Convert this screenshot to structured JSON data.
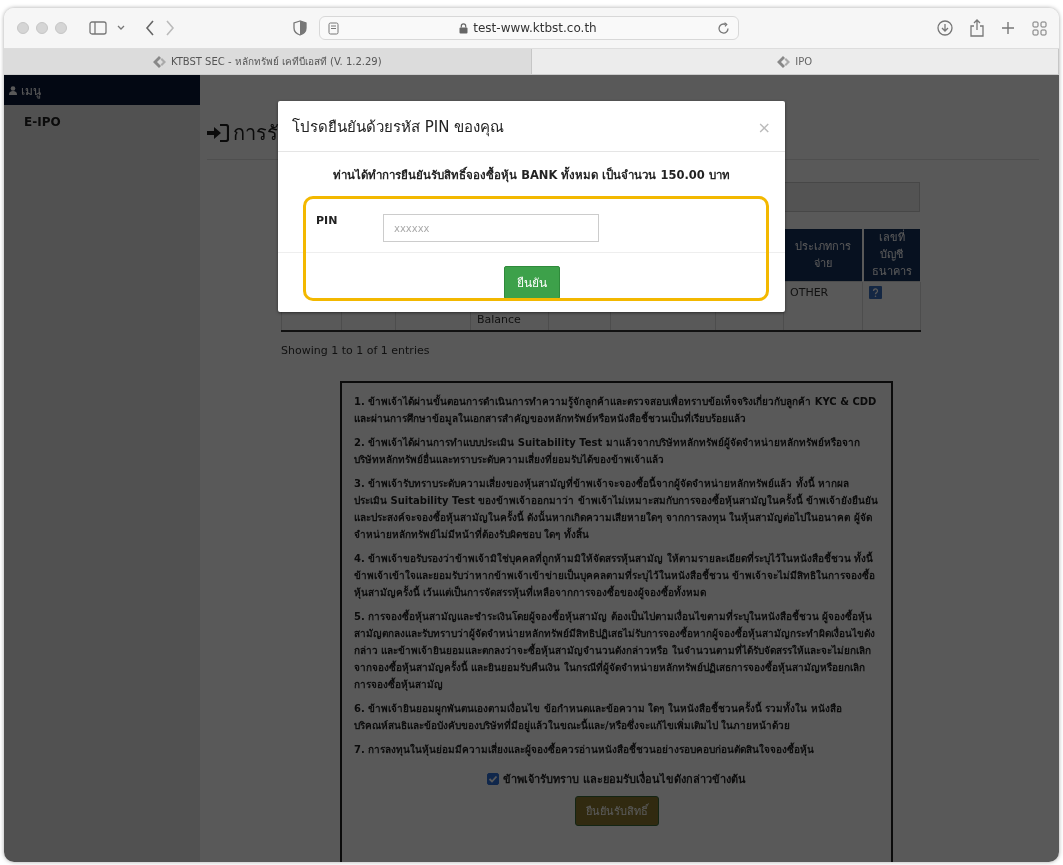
{
  "browser": {
    "url": "test-www.ktbst.co.th"
  },
  "tabs": [
    {
      "label": "KTBST SEC - หลักทรัพย์ เคทีบีเอสที (V. 1.2.29)",
      "selected": false
    },
    {
      "label": "IPO",
      "selected": true
    }
  ],
  "sidebar": {
    "header": "เมนู",
    "items": [
      {
        "label": "E-IPO"
      }
    ]
  },
  "page": {
    "heading": "การรั"
  },
  "table": {
    "columns": [
      "",
      "",
      "",
      "",
      "",
      "",
      "",
      "ประเภทการจ่าย",
      "เลขที่บัญชีธนาคาร"
    ],
    "rows": [
      {
        "cells": [
          "",
          "",
          "",
          "Balance",
          "",
          "",
          "",
          "OTHER",
          ""
        ]
      }
    ],
    "info": "Showing 1 to 1 of 1 entries"
  },
  "terms": [
    "1. ข้าพเจ้าได้ผ่านขั้นตอนการดำเนินการทำความรู้จักลูกค้าและตรวจสอบเพื่อทราบข้อเท็จจริงเกี่ยวกับลูกค้า KYC & CDD และผ่านการศึกษาข้อมูลในเอกสารสำคัญของหลักทรัพย์หรือหนังสือชี้ชวนเป็นที่เรียบร้อยแล้ว",
    "2. ข้าพเจ้าได้ผ่านการทำแบบประเมิน Suitability Test มาแล้วจากบริษัทหลักทรัพย์ผู้จัดจำหน่ายหลักทรัพย์หรือจากบริษัทหลักทรัพย์อื่นและทราบระดับความเสี่ยงที่ยอมรับได้ของข้าพเจ้าแล้ว",
    "3. ข้าพเจ้ารับทราบระดับความเสี่ยงของหุ้นสามัญที่ข้าพเจ้าจะจองซื้อนี้จากผู้จัดจำหน่ายหลักทรัพย์แล้ว ทั้งนี้ หากผลประเมิน Suitability Test ของข้าพเจ้าออกมาว่า ข้าพเจ้าไม่เหมาะสมกับการจองซื้อหุ้นสามัญในครั้งนี้ ข้าพเจ้ายังยืนยันและประสงค์จะจองซื้อหุ้นสามัญในครั้งนี้ ดังนั้นหากเกิดความเสียหายใดๆ จากการลงทุน ในหุ้นสามัญต่อไปในอนาคต ผู้จัดจำหน่ายหลักทรัพย์ไม่มีหน้าที่ต้องรับผิดชอบ ใดๆ ทั้งสิ้น",
    "4. ข้าพเจ้าขอรับรองว่าข้าพเจ้ามิใช่บุคคลที่ถูกห้ามมิให้จัดสรรหุ้นสามัญ ให้ตามรายละเอียดที่ระบุไว้ในหนังสือชี้ชวน ทั้งนี้ข้าพเจ้าเข้าใจและยอมรับว่าหากข้าพเจ้าเข้าข่ายเป็นบุคคลตามที่ระบุไว้ในหนังสือชี้ชวน ข้าพเจ้าจะไม่มีสิทธิในการจองซื้อหุ้นสามัญครั้งนี้ เว้นแต่เป็นการจัดสรรหุ้นที่เหลือจากการจองซื้อของผู้จองซื้อทั้งหมด",
    "5. การจองซื้อหุ้นสามัญและชำระเงินโดยผู้จองซื้อหุ้นสามัญ ต้องเป็นไปตามเงื่อนไขตามที่ระบุในหนังสือชี้ชวน ผู้จองซื้อหุ้นสามัญตกลงและรับทราบว่าผู้จัดจำหน่ายหลักทรัพย์มีสิทธิปฏิเสธไม่รับการจองซื้อหากผู้จองซื้อหุ้นสามัญกระทำผิดเงื่อนไขดังกล่าว และข้าพเจ้ายินยอมและตกลงว่าจะซื้อหุ้นสามัญจำนวนดังกล่าวหรือ ในจำนวนตามที่ได้รับจัดสรรให้และจะไม่ยกเลิกจากจองซื้อหุ้นสามัญครั้งนี้ และยินยอมรับคืนเงิน ในกรณีที่ผู้จัดจำหน่ายหลักทรัพย์ปฏิเสธการจองซื้อหุ้นสามัญหรือยกเลิกการจองซื้อหุ้นสามัญ",
    "6. ข้าพเจ้ายินยอมผูกพันตนเองตามเงื่อนไข ข้อกำหนดและข้อความ ใดๆ ในหนังสือชี้ชวนครั้งนี้ รวมทั้งใน หนังสือบริคณห์สนธิและข้อบังคับของบริษัทที่มีอยู่แล้วในขณะนี้และ/หรือซึ่งจะแก้ไขเพิ่มเติมไป ในภายหน้าด้วย",
    "7. การลงทุนในหุ้นย่อมมีความเสี่ยงและผู้จองซื้อควรอ่านหนังสือชี้ชวนอย่างรอบคอบก่อนตัดสินใจจองซื้อหุ้น"
  ],
  "consent": {
    "label": "ข้าพเจ้ารับทราบ และยอมรับเงื่อนไขดังกล่าวข้างต้น",
    "checked": true
  },
  "submit": {
    "label": "ยืนยันรับสิทธิ์",
    "disabled": true
  },
  "modal": {
    "title": "โปรดยืนยันด้วยรหัส PIN ของคุณ",
    "close": "×",
    "message": "ท่านได้ทำการยืนยันรับสิทธิ์จองซื้อหุ้น BANK ทั้งหมด เป็นจำนวน 150.00 บาท",
    "pin_label": "PIN",
    "placeholder": "xxxxxx",
    "confirm": "ยืนยัน"
  }
}
